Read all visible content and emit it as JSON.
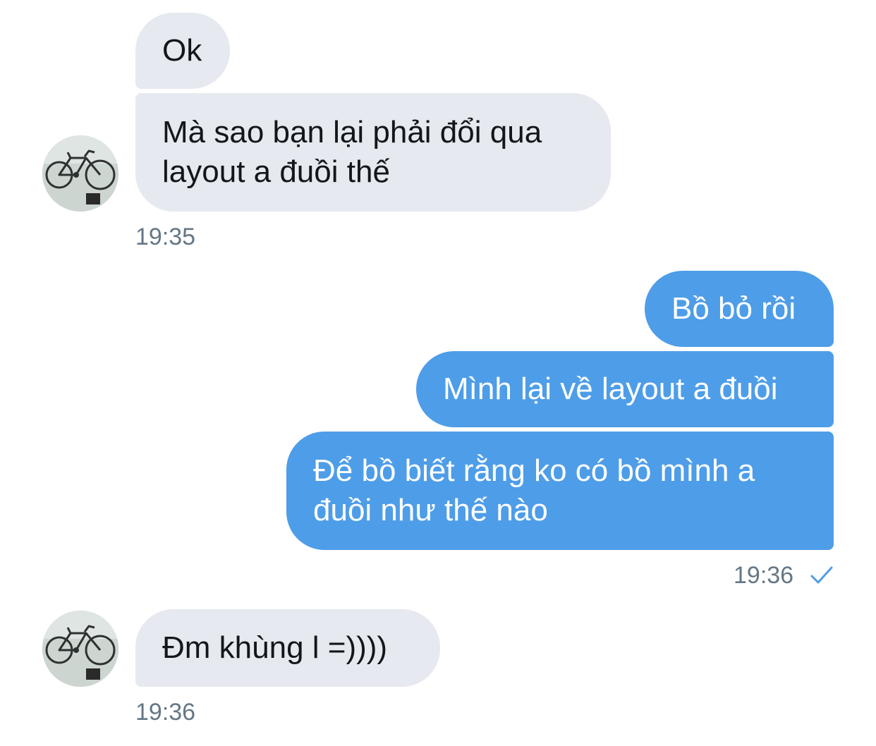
{
  "messages": [
    {
      "dir": "in",
      "text": "Ok"
    },
    {
      "dir": "in",
      "text": "Mà sao bạn lại phải đổi qua layout a đuồi thế"
    },
    {
      "dir": "out",
      "text": "Bồ bỏ rồi"
    },
    {
      "dir": "out",
      "text": "Mình lại về layout a đuồi"
    },
    {
      "dir": "out",
      "text": "Để bồ biết rằng ko có bồ mình a đuồi như thế nào"
    },
    {
      "dir": "in",
      "text": "Đm khùng l =))))"
    }
  ],
  "timestamps": {
    "first": "19:35",
    "second": "19:36",
    "third": "19:36"
  },
  "icons": {
    "avatar": "bicycle-avatar-icon",
    "read_receipt": "checkmark-icon"
  },
  "colors": {
    "incoming_bubble": "#e6e9ef",
    "outgoing_bubble": "#4e9de8",
    "timestamp": "#657786",
    "checkmark": "#4e9de8"
  }
}
